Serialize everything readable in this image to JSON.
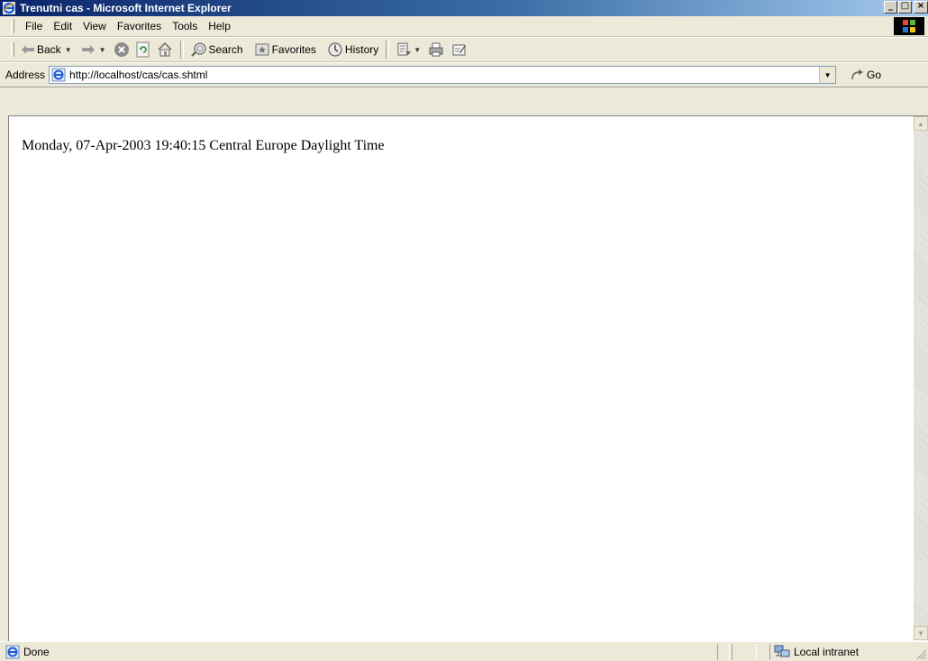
{
  "window": {
    "title": "Trenutni cas - Microsoft Internet Explorer",
    "caption_buttons": {
      "minimize": "_",
      "maximize": "□",
      "close": "×"
    }
  },
  "menubar": {
    "items": [
      "File",
      "Edit",
      "View",
      "Favorites",
      "Tools",
      "Help"
    ]
  },
  "toolbar": {
    "back_label": "Back",
    "search_label": "Search",
    "favorites_label": "Favorites",
    "history_label": "History",
    "icons": [
      "back-arrow-icon",
      "forward-arrow-icon",
      "stop-icon",
      "refresh-icon",
      "home-icon",
      "search-icon",
      "favorites-icon",
      "history-icon",
      "mail-icon",
      "print-icon",
      "edit-icon"
    ]
  },
  "address": {
    "label": "Address",
    "url": "http://localhost/cas/cas.shtml",
    "go_label": "Go"
  },
  "content": {
    "text": "Monday, 07-Apr-2003 19:40:15 Central Europe Daylight Time"
  },
  "statusbar": {
    "status_text": "Done",
    "zone_text": "Local intranet"
  },
  "colors": {
    "title_gradient_start": "#0a246a",
    "title_gradient_end": "#a6caf0",
    "chrome": "#ece9d8",
    "page_background": "#ffffff"
  }
}
